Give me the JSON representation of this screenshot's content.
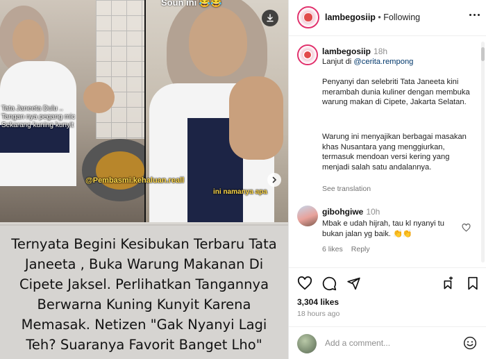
{
  "media": {
    "top_caption": "Soun ini 😂😂",
    "left_overlay_lines": [
      "Tata Janeeta Dulu ..",
      "Tangan nya pegang mic",
      "Sekarang kuning kunyit"
    ],
    "handle_tag": "@Pembasmi.kehaluan.reall",
    "right_overlay": "ini namanya apa",
    "headline": "Ternyata Begini Kesibukan Terbaru Tata Janeeta , Buka Warung  Makanan Di Cipete Jaksel. Perlihatkan Tangannya Berwarna Kuning Kunyit Karena Memasak. Netizen \"Gak Nyanyi Lagi Teh? Suaranya Favorit Banget Lho\"",
    "download_icon": "download-icon",
    "next_icon": "chevron-right-icon"
  },
  "header": {
    "username": "lambegosiip",
    "separator": "•",
    "follow_status": "Following",
    "more_icon": "more-horizontal-icon"
  },
  "caption": {
    "username": "lambegosiip",
    "time": "18h",
    "line1_prefix": "Lanjut di ",
    "line1_mention": "@cerita.rempong",
    "paragraph1": "Penyanyi dan selebriti Tata Janeeta kini merambah dunia kuliner dengan membuka warung makan di Cipete, Jakarta Selatan.",
    "paragraph2": "Warung ini menyajikan berbagai masakan khas Nusantara yang menggiurkan, termasuk mendoan versi kering yang menjadi salah satu andalannya.",
    "see_translation": "See translation"
  },
  "comment": {
    "username": "gibohgiwe",
    "time": "10h",
    "text": "Mbak e udah hijrah, tau kl nyanyi tu bukan jalan yg baik. 👏👏",
    "likes": "6 likes",
    "reply": "Reply"
  },
  "actions": {
    "likes_count": "3,304 likes",
    "posted_ago": "18 hours ago",
    "icons": [
      "heart-icon",
      "comment-icon",
      "share-icon",
      "save-icon"
    ]
  },
  "add_comment": {
    "placeholder": "Add a comment...",
    "emoji_icon": "emoji-icon"
  },
  "colors": {
    "avatar_ring": "#e1306c",
    "mention": "#00376b",
    "muted": "#737373",
    "handle_tag": "#ffd84a"
  }
}
